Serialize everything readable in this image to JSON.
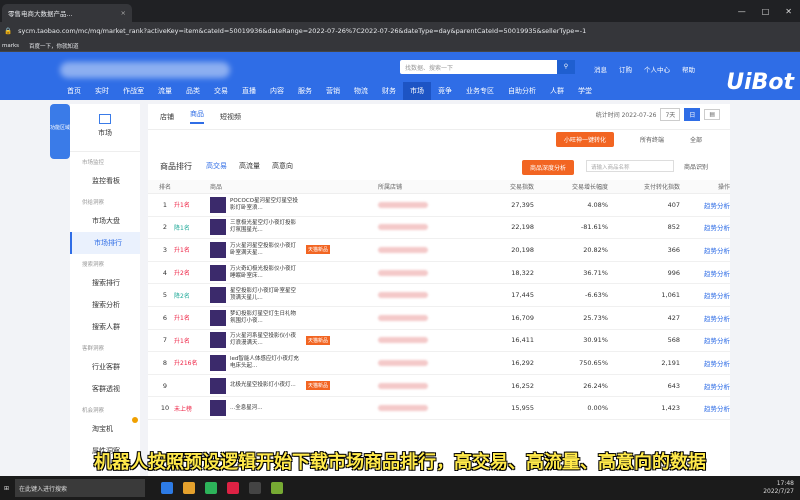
{
  "browser": {
    "tab_title": "零售电商大数据产品...",
    "tab_close": "×",
    "url": "sycm.taobao.com/mc/mq/market_rank?activeKey=item&cateId=50019936&dateRange=2022-07-26%7C2022-07-26&dateType=day&parentCateId=50019935&sellerType=-1",
    "bookmarks_label": "marks",
    "bookmark_item": "百度一下，你就知道"
  },
  "header": {
    "search_placeholder": "找数据、搜索一下",
    "top_links": [
      "消息",
      "订购",
      "个人中心",
      "帮助"
    ],
    "nav_items": [
      "首页",
      "实时",
      "作战室",
      "流量",
      "品类",
      "交易",
      "直播",
      "内容",
      "服务",
      "营销",
      "物流",
      "财务",
      "市场",
      "竞争",
      "业务专区",
      "自助分析",
      "人群",
      "学堂"
    ],
    "nav_active": "市场",
    "brand": "UiBot"
  },
  "leftpanel": {
    "label": "功能区域"
  },
  "sidebar": {
    "title": "市场",
    "groups": [
      {
        "label": "市场监控",
        "items": [
          "监控看板"
        ]
      },
      {
        "label": "供给洞察",
        "items": [
          "市场大盘",
          "市场排行"
        ]
      },
      {
        "label": "搜索洞察",
        "items": [
          "搜索排行",
          "搜索分析",
          "搜索人群"
        ]
      },
      {
        "label": "客群洞察",
        "items": [
          "行业客群",
          "客群透视"
        ]
      },
      {
        "label": "机会洞察",
        "items": [
          "淘宝机",
          "属性洞察"
        ]
      }
    ],
    "active_item": "市场排行"
  },
  "content": {
    "tabs": [
      "店铺",
      "商品",
      "短视频"
    ],
    "active_tab": "商品",
    "stat_time": "统计时间 2022-07-26",
    "range_buttons": [
      "7天",
      "日"
    ],
    "orange_btn1": "小旺神一键转化",
    "filter1": "所有终端",
    "filter2": "全部",
    "section_title": "商品排行",
    "section_tabs": [
      "高交易",
      "高流量",
      "高意向"
    ],
    "orange_btn2": "商品深度分析",
    "search_placeholder": "请输入商品名称",
    "search_mode": "商品识别",
    "headers": [
      "排名",
      "商品",
      "所属店铺",
      "交易指数",
      "交易增长幅度",
      "支付转化指数",
      "操作"
    ]
  },
  "rows": [
    {
      "rank": "1",
      "change": "升1名",
      "dir": "up",
      "name": "POCOCO星河星空灯星空投影灯卧室浪...",
      "tag": "",
      "idx": "27,395",
      "growth": "4.08%",
      "conv": "407",
      "op": "趋势分析"
    },
    {
      "rank": "2",
      "change": "降1名",
      "dir": "down",
      "name": "三意极光星空灯小夜灯投影灯氛围星光...",
      "tag": "",
      "idx": "22,198",
      "growth": "-81.61%",
      "conv": "852",
      "op": "趋势分析"
    },
    {
      "rank": "3",
      "change": "升1名",
      "dir": "up",
      "name": "万火星河星空投影仪小夜灯卧室满天星...",
      "tag": "天猫新品",
      "idx": "20,198",
      "growth": "20.82%",
      "conv": "366",
      "op": "趋势分析"
    },
    {
      "rank": "4",
      "change": "升2名",
      "dir": "up",
      "name": "万火奇幻极光投影仪小夜灯睡眠卧室床...",
      "tag": "",
      "idx": "18,322",
      "growth": "36.71%",
      "conv": "996",
      "op": "趋势分析"
    },
    {
      "rank": "5",
      "change": "降2名",
      "dir": "down",
      "name": "星空投影灯小夜灯卧室星空顶满天星儿...",
      "tag": "",
      "idx": "17,445",
      "growth": "-6.63%",
      "conv": "1,061",
      "op": "趋势分析"
    },
    {
      "rank": "6",
      "change": "升1名",
      "dir": "up",
      "name": "梦幻投影灯星空灯生日礼物氛围灯小夜...",
      "tag": "",
      "idx": "16,709",
      "growth": "25.73%",
      "conv": "427",
      "op": "趋势分析"
    },
    {
      "rank": "7",
      "change": "升1名",
      "dir": "up",
      "name": "万火星河系星空投影仪小夜灯浪漫满天...",
      "tag": "天猫新品",
      "idx": "16,411",
      "growth": "30.91%",
      "conv": "568",
      "op": "趋势分析"
    },
    {
      "rank": "8",
      "change": "升216名",
      "dir": "up",
      "name": "led智能人体感应灯小夜灯充电床头起...",
      "tag": "",
      "idx": "16,292",
      "growth": "750.65%",
      "conv": "2,191",
      "op": "趋势分析"
    },
    {
      "rank": "9",
      "change": "",
      "dir": "up",
      "name": "北极光星空投影灯小夜灯...",
      "tag": "天猫新品",
      "idx": "16,252",
      "growth": "26.24%",
      "conv": "643",
      "op": "趋势分析"
    },
    {
      "rank": "10",
      "change": "未上榜",
      "dir": "up",
      "name": "...全息星河...",
      "tag": "",
      "idx": "15,955",
      "growth": "0.00%",
      "conv": "1,423",
      "op": "趋势分析"
    }
  ],
  "subtitle": "机器人按照预设逻辑开始下载市场商品排行，高交易、高流量、高意向的数据",
  "taskbar": {
    "search_placeholder": "在此键入进行搜索",
    "time": "17:48",
    "date": "2022/7/27"
  },
  "colors": {
    "brand_blue": "#2f6de6",
    "orange": "#f26522",
    "subtitle_yellow": "#ffe94a"
  }
}
